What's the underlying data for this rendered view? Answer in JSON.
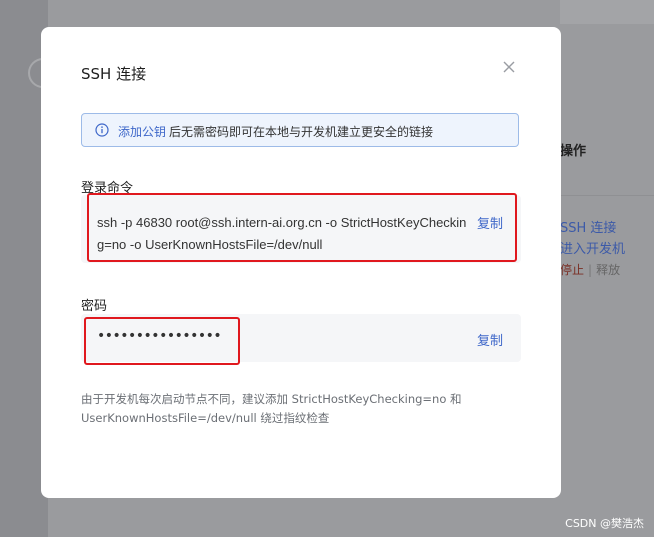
{
  "background": {
    "ops_header": "操作",
    "ssh_connect_link": "SSH 连接",
    "enter_dev_link": "进入开发机",
    "stop_link": "停止",
    "separator": "|",
    "release_link": "释放"
  },
  "modal": {
    "title": "SSH 连接",
    "info": {
      "link": "添加公钥",
      "text": "后无需密码即可在本地与开发机建立更安全的链接"
    },
    "command": {
      "label": "登录命令",
      "value": "ssh -p 46830 root@ssh.intern-ai.org.cn -o StrictHostKeyChecking=no -o UserKnownHostsFile=/dev/null",
      "copy_label": "复制"
    },
    "password": {
      "label": "密码",
      "value": "••••••••••••••••",
      "copy_label": "复制"
    },
    "hint": "由于开发机每次启动节点不同，建议添加 StrictHostKeyChecking=no 和 UserKnownHostsFile=/dev/null 绕过指纹检查"
  },
  "watermark": "CSDN @樊浩杰",
  "colors": {
    "accent": "#3e67c9",
    "highlight": "#e0181e",
    "stop": "#7a2f25"
  }
}
